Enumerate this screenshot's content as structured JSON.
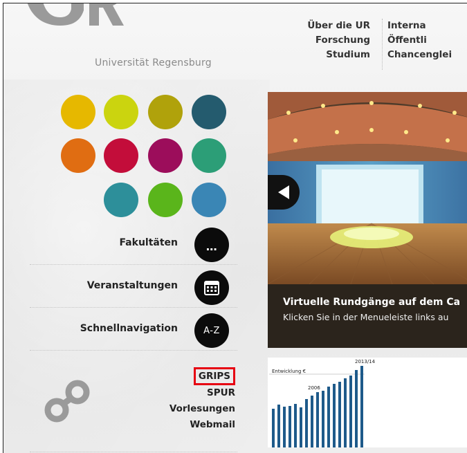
{
  "logo": {
    "subtitle": "Universität Regensburg"
  },
  "topnav": {
    "col1": [
      "Über die UR",
      "Forschung",
      "Studium"
    ],
    "col2": [
      "Interna",
      "Öffentli",
      "Chancenglei"
    ]
  },
  "colors": {
    "dots": [
      "#e6b800",
      "#cbd40f",
      "#b0a20b",
      "#245b6e",
      "#e06d12",
      "#c30d3a",
      "#9c0d5b",
      "#2c9e77",
      "#2d8f9a",
      "#5ab51b",
      "#3a86b5"
    ],
    "highlight": "#e60012"
  },
  "menu": {
    "faculties": {
      "label": "Fakultäten",
      "icon": "ellipsis-icon",
      "glyph": "…"
    },
    "events": {
      "label": "Veranstaltungen",
      "icon": "calendar-icon"
    },
    "quicknav": {
      "label": "Schnellnavigation",
      "icon": "az-icon",
      "glyph": "A-Z"
    }
  },
  "links": [
    "GRIPS",
    "SPUR",
    "Vorlesungen",
    "Webmail"
  ],
  "slider": {
    "title": "Virtuelle Rundgänge auf dem Ca",
    "text": "Klicken Sie in der Menueleiste links au",
    "prev_icon": "arrow-left-icon"
  },
  "teaser": {
    "chart_title": "Entwicklung €",
    "label_start": "2006",
    "label_end": "2013/14"
  }
}
